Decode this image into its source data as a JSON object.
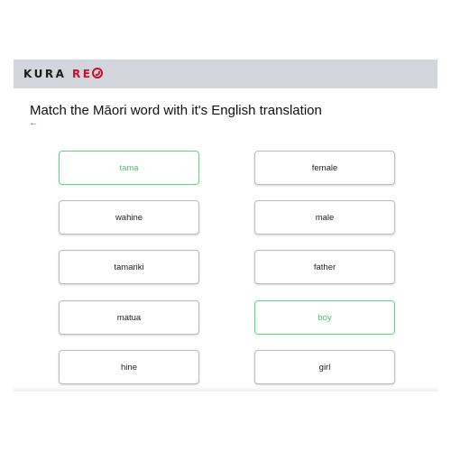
{
  "header": {
    "brand_kura": "KURA ",
    "brand_reo": "RE"
  },
  "title": "Match the Māori word with it's English translation",
  "back_arrow": "←",
  "maori_words": [
    {
      "label": "tama",
      "state": "matched"
    },
    {
      "label": "wahine",
      "state": "default"
    },
    {
      "label": "tamariki",
      "state": "default"
    },
    {
      "label": "matua",
      "state": "default"
    },
    {
      "label": "hine",
      "state": "default"
    }
  ],
  "english_words": [
    {
      "label": "female",
      "state": "default"
    },
    {
      "label": "male",
      "state": "default"
    },
    {
      "label": "father",
      "state": "default"
    },
    {
      "label": "boy",
      "state": "matched"
    },
    {
      "label": "girl",
      "state": "default"
    }
  ],
  "colors": {
    "header_bg": "#d3d5dc",
    "brand_accent": "#c8102e",
    "matched_border": "#57d97a",
    "matched_text": "#4cc36a",
    "back_arrow": "#d9232d"
  }
}
